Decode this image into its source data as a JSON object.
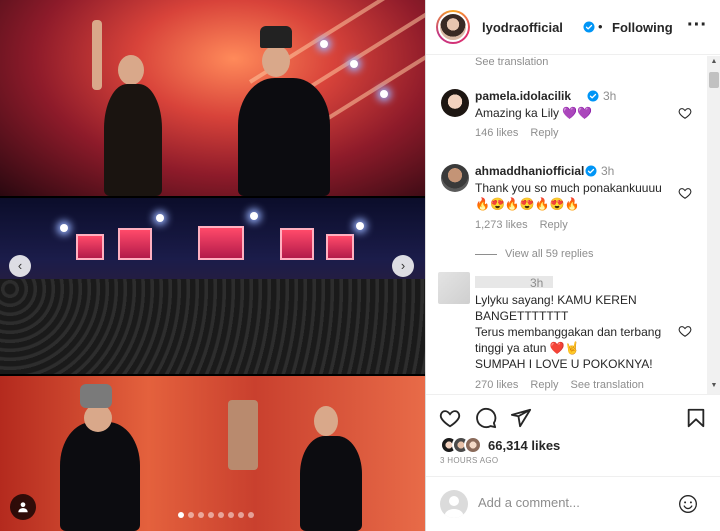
{
  "post": {
    "owner": "lyodraofficial",
    "separator": "•",
    "follow_status": "Following",
    "more_label": "···"
  },
  "carousel": {
    "prev_label": "‹",
    "next_label": "›",
    "slide_count": 8,
    "active_slide": 0
  },
  "comments": {
    "see_translation": "See translation",
    "items": [
      {
        "user": "pamela.idolacilik",
        "verified": true,
        "time": "3h",
        "text": "Amazing ka Lily 💜💜",
        "likes": "146 likes",
        "reply": "Reply"
      },
      {
        "user": "ahmaddhaniofficial",
        "verified": true,
        "time": "3h",
        "text": "Thank you so much ponakankuuuu\n🔥😍🔥😍🔥😍🔥",
        "likes": "1,273 likes",
        "reply": "Reply"
      },
      {
        "user": "",
        "verified": false,
        "time": "3h",
        "text": "Lylyku sayang! KAMU KEREN BANGETTTTTTT\nTerus membanggakan dan terbang tinggi ya atun ❤️🤘\nSUMPAH I LOVE U POKOKNYA!",
        "likes": "270 likes",
        "reply": "Reply",
        "translate": "See translation"
      }
    ],
    "view_replies": "View all 59 replies"
  },
  "actions": {
    "likes": "66,314 likes",
    "posted": "3 HOURS AGO"
  },
  "composer": {
    "placeholder": "Add a comment..."
  },
  "icons": {
    "verified": "verified-badge-icon",
    "heart": "heart-icon",
    "comment": "comment-icon",
    "share": "share-icon",
    "save": "bookmark-icon",
    "emoji": "emoji-icon",
    "user_tag": "user-tag-icon"
  },
  "colors": {
    "verified": "#0095f6",
    "muted": "#8e8e8e",
    "text": "#262626"
  }
}
